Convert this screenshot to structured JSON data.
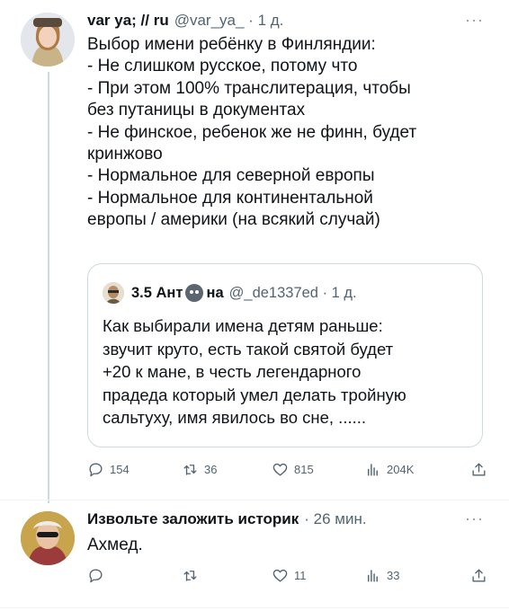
{
  "post1": {
    "display_name": "var ya; // ru",
    "handle_time": "@var_ya_ · 1 д.",
    "more_icon": "more-horizontal-icon",
    "lines": [
      "Выбор имени ребёнку в Финляндии:",
      "- Не слишком русское, потому что",
      "- При этом 100% транслитерация, чтобы",
      "без путаницы в документах",
      "- Не финское, ребенок же не финн, будет",
      "кринжово",
      "- Нормальное для северной европы",
      "- Нормальное для континентальной",
      "европы / америки (на всякий случай)"
    ],
    "quote": {
      "name_part1": "3.5 Ант",
      "name_part2": "на",
      "handle_time": "@_de1337ed · 1 д.",
      "lines": [
        "Как выбирали имена детям раньше:",
        "звучит круто, есть такой святой будет",
        "+20 к мане, в честь легендарного",
        "прадеда который умел делать тройную",
        "сальтуху, имя явилось во сне, ......"
      ]
    },
    "actions": {
      "reply": "154",
      "retweet": "36",
      "like": "815",
      "views": "204K"
    }
  },
  "post2": {
    "display_name": "Извольте заложить историк",
    "handle_time": "· 26 мин.",
    "text": "Ахмед.",
    "actions": {
      "reply": "",
      "retweet": "",
      "like": "11",
      "views": "33"
    }
  },
  "colors": {
    "text": "#0f1419",
    "secondary": "#536471",
    "border": "#cfd9de"
  }
}
